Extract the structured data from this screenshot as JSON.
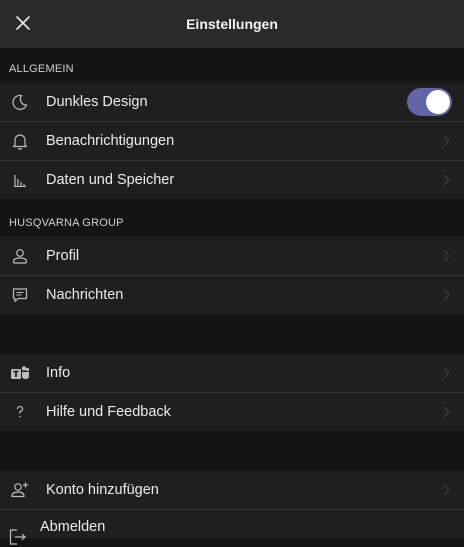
{
  "header": {
    "title": "Einstellungen"
  },
  "sections": {
    "general": {
      "title": "ALLGEMEIN",
      "dark_design": {
        "label": "Dunkles Design",
        "enabled": true
      },
      "notifications": {
        "label": "Benachrichtigungen"
      },
      "data_storage": {
        "label": "Daten und Speicher"
      }
    },
    "org": {
      "title": "HUSQVARNA GROUP",
      "profile": {
        "label": "Profil"
      },
      "messages": {
        "label": "Nachrichten"
      }
    },
    "about": {
      "info": {
        "label": "Info"
      },
      "help": {
        "label": "Hilfe und Feedback"
      }
    },
    "account": {
      "add_account": {
        "label": "Konto hinzufügen"
      },
      "sign_out": {
        "label": "Abmelden"
      }
    }
  },
  "colors": {
    "accent": "#6264a7",
    "background": "#141414",
    "row": "#1f1f1f",
    "header": "#2a2a2a"
  }
}
